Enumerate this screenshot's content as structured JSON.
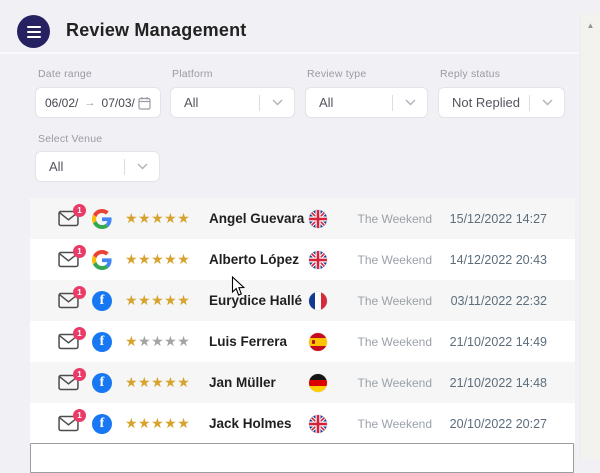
{
  "header": {
    "title": "Review Management"
  },
  "filters": {
    "date_range": {
      "label": "Date range",
      "start": "06/02/",
      "end": "07/03/",
      "arrow": "→"
    },
    "platform": {
      "label": "Platform",
      "value": "All"
    },
    "review_type": {
      "label": "Review type",
      "value": "All"
    },
    "reply_status": {
      "label": "Reply status",
      "value": "Not Replied"
    },
    "venue": {
      "label": "Select Venue",
      "value": "All"
    }
  },
  "reviews": [
    {
      "platform": "google",
      "stars": 5,
      "max_stars": 5,
      "name": "Angel Guevara",
      "flag": "gb",
      "flag_name": "united-kingdom-flag",
      "venue": "The Weekend",
      "date": "15/12/2022 14:27",
      "unread_count": "1"
    },
    {
      "platform": "google",
      "stars": 5,
      "max_stars": 5,
      "name": "Alberto López",
      "flag": "gb",
      "flag_name": "united-kingdom-flag",
      "venue": "The Weekend",
      "date": "14/12/2022 20:43",
      "unread_count": "1"
    },
    {
      "platform": "facebook",
      "stars": 5,
      "max_stars": 5,
      "name": "Eurydice Hallé",
      "flag": "fr",
      "flag_name": "france-flag",
      "venue": "The Weekend",
      "date": "03/11/2022 22:32",
      "unread_count": "1"
    },
    {
      "platform": "facebook",
      "stars": 1,
      "max_stars": 5,
      "name": "Luis Ferrera",
      "flag": "es",
      "flag_name": "spain-flag",
      "venue": "The Weekend",
      "date": "21/10/2022 14:49",
      "unread_count": "1"
    },
    {
      "platform": "facebook",
      "stars": 5,
      "max_stars": 5,
      "name": "Jan Müller",
      "flag": "de",
      "flag_name": "germany-flag",
      "venue": "The Weekend",
      "date": "21/10/2022 14:48",
      "unread_count": "1"
    },
    {
      "platform": "facebook",
      "stars": 5,
      "max_stars": 5,
      "name": "Jack Holmes",
      "flag": "gb",
      "flag_name": "united-kingdom-flag",
      "venue": "The Weekend",
      "date": "20/10/2022 20:27",
      "unread_count": "1"
    }
  ],
  "colors": {
    "accent_navy": "#262262",
    "badge_pink": "#eb3a68",
    "star_gold": "#d7a32e",
    "star_gray": "#a3a3a3",
    "facebook_blue": "#1877f2"
  }
}
